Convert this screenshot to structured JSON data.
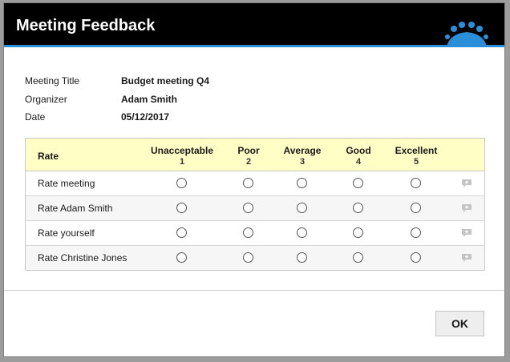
{
  "dialog": {
    "title": "Meeting Feedback"
  },
  "colors": {
    "titlebar": "#000000",
    "accent": "#2a8fd8",
    "header_bg": "#fefec5"
  },
  "info": [
    {
      "label": "Meeting Title",
      "value": "Budget meeting Q4"
    },
    {
      "label": "Organizer",
      "value": "Adam Smith"
    },
    {
      "label": "Date",
      "value": "05/12/2017"
    }
  ],
  "rating": {
    "header": "Rate",
    "columns": [
      {
        "label": "Unacceptable",
        "num": "1"
      },
      {
        "label": "Poor",
        "num": "2"
      },
      {
        "label": "Average",
        "num": "3"
      },
      {
        "label": "Good",
        "num": "4"
      },
      {
        "label": "Excellent",
        "num": "5"
      }
    ],
    "rows": [
      {
        "label": "Rate meeting"
      },
      {
        "label": "Rate Adam Smith"
      },
      {
        "label": "Rate yourself"
      },
      {
        "label": "Rate Christine Jones"
      }
    ]
  },
  "footer": {
    "ok_label": "OK"
  }
}
